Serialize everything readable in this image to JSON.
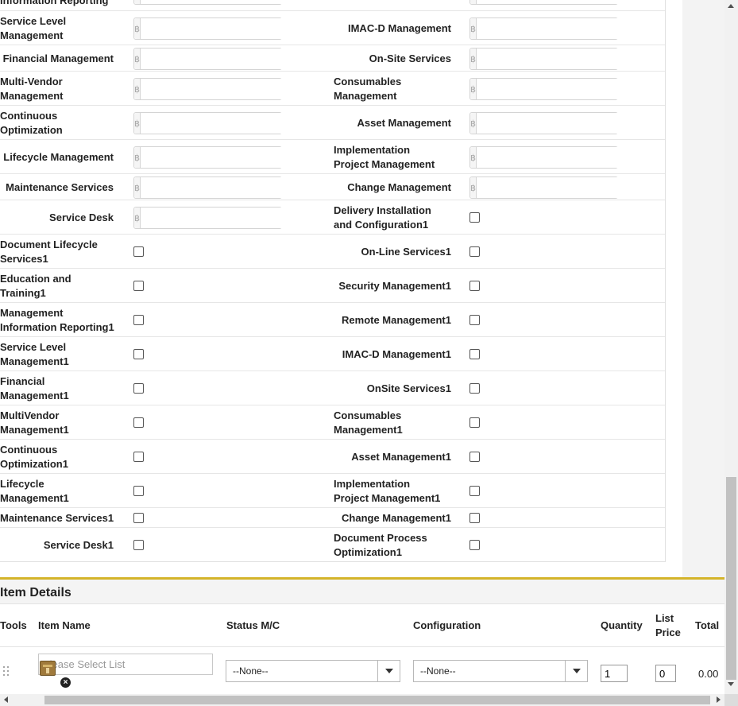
{
  "form": {
    "top_partial_label": "Information Reporting",
    "currency_symbol": "฿",
    "currency_rows": [
      {
        "left": "Service Level\nManagement",
        "right": "IMAC-D Management"
      },
      {
        "left": "Financial Management",
        "right": "On-Site Services"
      },
      {
        "left": "Multi-Vendor\nManagement",
        "right": "Consumables\nManagement"
      },
      {
        "left": "Continuous\nOptimization",
        "right": "Asset Management"
      },
      {
        "left": "Lifecycle Management",
        "right": "Implementation\nProject Management"
      },
      {
        "left": "Maintenance Services",
        "right": "Change Management"
      },
      {
        "left": "Service Desk",
        "right": "Delivery Installation\nand Configuration1"
      }
    ],
    "checkbox_rows": [
      {
        "left": "Document Lifecycle\nServices1",
        "right": "On-Line Services1"
      },
      {
        "left": "Education and\nTraining1",
        "right": "Security Management1"
      },
      {
        "left": "Management\nInformation Reporting1",
        "right": "Remote Management1"
      },
      {
        "left": "Service Level\nManagement1",
        "right": "IMAC-D Management1"
      },
      {
        "left": "Financial\nManagement1",
        "right": "OnSite Services1"
      },
      {
        "left": "MultiVendor\nManagement1",
        "right": "Consumables\nManagement1"
      },
      {
        "left": "Continuous\nOptimization1",
        "right": "Asset Management1"
      },
      {
        "left": "Lifecycle\nManagement1",
        "right": "Implementation\nProject Management1"
      },
      {
        "left": "Maintenance Services1",
        "right": "Change Management1"
      },
      {
        "left": "Service Desk1",
        "right": "Document Process\nOptimization1"
      }
    ]
  },
  "item_details": {
    "title": "Item Details",
    "columns": {
      "tools": "Tools",
      "item_name": "Item Name",
      "status": "Status M/C",
      "configuration": "Configuration",
      "quantity": "Quantity",
      "list_price": "List\nPrice",
      "total": "Total"
    },
    "row": {
      "item_name_placeholder": "Please Select List",
      "status_value": "--None--",
      "configuration_value": "--None--",
      "quantity_value": "1",
      "list_price_value": "0",
      "total_value": "0.00"
    }
  },
  "icons": {
    "lookup": "product-lookup-icon",
    "clear": "clear-icon",
    "drag": "drag-handle-icon"
  },
  "colors": {
    "section_accent": "#d4b42a"
  }
}
